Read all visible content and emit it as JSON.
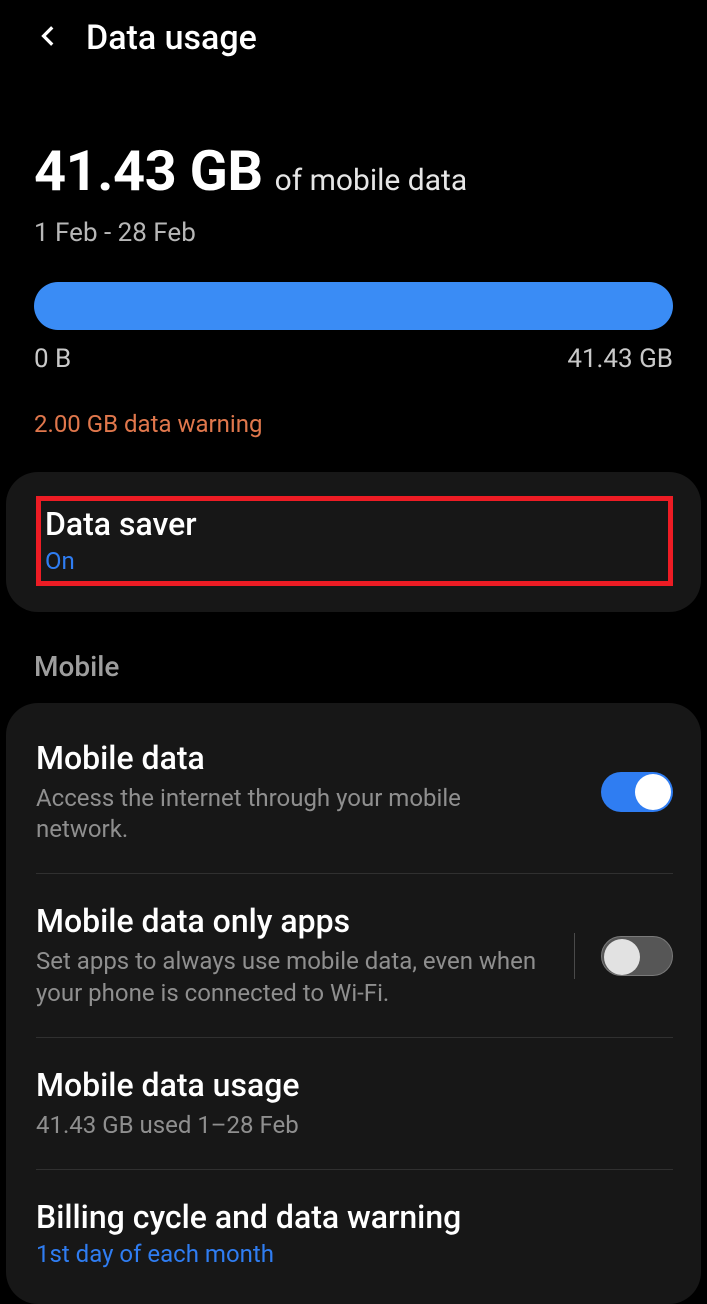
{
  "header": {
    "title": "Data usage"
  },
  "usage": {
    "amount": "41.43 GB",
    "suffix": "of mobile data",
    "range": "1 Feb - 28 Feb",
    "min_label": "0 B",
    "max_label": "41.43 GB",
    "warning": "2.00 GB data warning"
  },
  "data_saver": {
    "title": "Data saver",
    "status": "On"
  },
  "section": "Mobile",
  "mobile_data": {
    "title": "Mobile data",
    "desc": "Access the internet through your mobile network.",
    "enabled": true
  },
  "only_apps": {
    "title": "Mobile data only apps",
    "desc": "Set apps to always use mobile data, even when your phone is connected to Wi-Fi.",
    "enabled": false
  },
  "mobile_usage": {
    "title": "Mobile data usage",
    "desc": "41.43 GB used 1–28 Feb"
  },
  "billing": {
    "title": "Billing cycle and data warning",
    "desc": "1st day of each month"
  },
  "colors": {
    "accent": "#2f7df2",
    "warning": "#e0774c",
    "highlight": "#ed1c24"
  }
}
